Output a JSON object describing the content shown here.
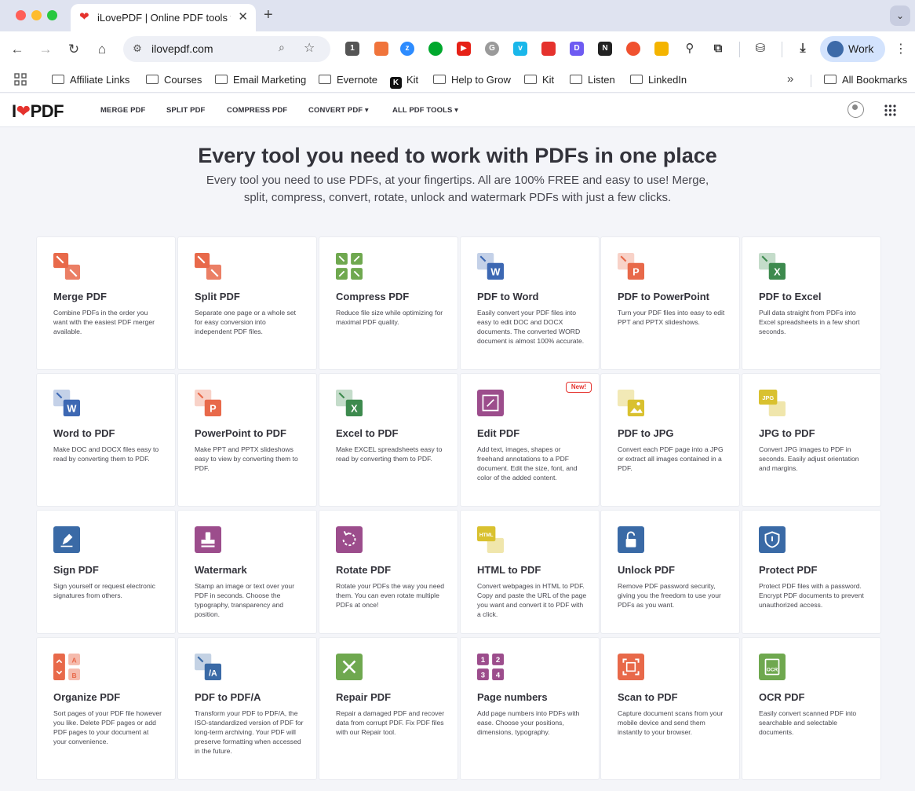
{
  "browser": {
    "tab_title": "iLovePDF | Online PDF tools for PDF lovers",
    "url": "ilovepdf.com",
    "profile": "Work",
    "extension_badge": "1",
    "bookmarks": [
      "Affiliate Links",
      "Courses",
      "Email Marketing",
      "Evernote",
      "Kit",
      "Help to Grow",
      "Kit",
      "Listen",
      "LinkedIn"
    ],
    "all_bookmarks": "All Bookmarks"
  },
  "site": {
    "logo_prefix": "I",
    "logo_suffix": "PDF",
    "nav": [
      "MERGE PDF",
      "SPLIT PDF",
      "COMPRESS PDF",
      "CONVERT PDF ▾",
      "ALL PDF TOOLS ▾"
    ]
  },
  "hero": {
    "title": "Every tool you need to work with PDFs in one place",
    "subtitle": "Every tool you need to use PDFs, at your fingertips. All are 100% FREE and easy to use! Merge, split, compress, convert, rotate, unlock and watermark PDFs with just a few clicks."
  },
  "tools": [
    {
      "title": "Merge PDF",
      "desc": "Combine PDFs in the order you want with the easiest PDF merger available.",
      "color": "#e8694a",
      "icon": "merge-icon"
    },
    {
      "title": "Split PDF",
      "desc": "Separate one page or a whole set for easy conversion into independent PDF files.",
      "color": "#e8694a",
      "icon": "split-icon"
    },
    {
      "title": "Compress PDF",
      "desc": "Reduce file size while optimizing for maximal PDF quality.",
      "color": "#6fa84f",
      "icon": "compress-icon"
    },
    {
      "title": "PDF to Word",
      "desc": "Easily convert your PDF files into easy to edit DOC and DOCX documents. The converted WORD document is almost 100% accurate.",
      "color": "#3d68b3",
      "icon": "word-icon",
      "glyph": "W"
    },
    {
      "title": "PDF to PowerPoint",
      "desc": "Turn your PDF files into easy to edit PPT and PPTX slideshows.",
      "color": "#e8694a",
      "icon": "powerpoint-icon",
      "glyph": "P"
    },
    {
      "title": "PDF to Excel",
      "desc": "Pull data straight from PDFs into Excel spreadsheets in a few short seconds.",
      "color": "#3d8a4e",
      "icon": "excel-icon",
      "glyph": "X"
    },
    {
      "title": "Word to PDF",
      "desc": "Make DOC and DOCX files easy to read by converting them to PDF.",
      "color": "#3d68b3",
      "icon": "word-icon",
      "glyph": "W"
    },
    {
      "title": "PowerPoint to PDF",
      "desc": "Make PPT and PPTX slideshows easy to view by converting them to PDF.",
      "color": "#e8694a",
      "icon": "powerpoint-icon",
      "glyph": "P"
    },
    {
      "title": "Excel to PDF",
      "desc": "Make EXCEL spreadsheets easy to read by converting them to PDF.",
      "color": "#3d8a4e",
      "icon": "excel-icon",
      "glyph": "X"
    },
    {
      "title": "Edit PDF",
      "desc": "Add text, images, shapes or freehand annotations to a PDF document. Edit the size, font, and color of the added content.",
      "color": "#9c4d8c",
      "icon": "edit-icon",
      "badge": "New!"
    },
    {
      "title": "PDF to JPG",
      "desc": "Convert each PDF page into a JPG or extract all images contained in a PDF.",
      "color": "#d9c12f",
      "icon": "image-icon"
    },
    {
      "title": "JPG to PDF",
      "desc": "Convert JPG images to PDF in seconds. Easily adjust orientation and margins.",
      "color": "#d9c12f",
      "icon": "jpg-icon",
      "glyph": "JPG"
    },
    {
      "title": "Sign PDF",
      "desc": "Sign yourself or request electronic signatures from others.",
      "color": "#3a6aa6",
      "icon": "pen-icon"
    },
    {
      "title": "Watermark",
      "desc": "Stamp an image or text over your PDF in seconds. Choose the typography, transparency and position.",
      "color": "#9c4d8c",
      "icon": "stamp-icon"
    },
    {
      "title": "Rotate PDF",
      "desc": "Rotate your PDFs the way you need them. You can even rotate multiple PDFs at once!",
      "color": "#9c4d8c",
      "icon": "rotate-icon"
    },
    {
      "title": "HTML to PDF",
      "desc": "Convert webpages in HTML to PDF. Copy and paste the URL of the page you want and convert it to PDF with a click.",
      "color": "#d9c12f",
      "icon": "html-icon",
      "glyph": "HTML"
    },
    {
      "title": "Unlock PDF",
      "desc": "Remove PDF password security, giving you the freedom to use your PDFs as you want.",
      "color": "#3a6aa6",
      "icon": "unlock-icon"
    },
    {
      "title": "Protect PDF",
      "desc": "Protect PDF files with a password. Encrypt PDF documents to prevent unauthorized access.",
      "color": "#3a6aa6",
      "icon": "shield-icon"
    },
    {
      "title": "Organize PDF",
      "desc": "Sort pages of your PDF file however you like. Delete PDF pages or add PDF pages to your document at your convenience.",
      "color": "#e8694a",
      "icon": "organize-icon"
    },
    {
      "title": "PDF to PDF/A",
      "desc": "Transform your PDF to PDF/A, the ISO-standardized version of PDF for long-term archiving. Your PDF will preserve formatting when accessed in the future.",
      "color": "#3a6aa6",
      "icon": "pdfa-icon",
      "glyph": "/A"
    },
    {
      "title": "Repair PDF",
      "desc": "Repair a damaged PDF and recover data from corrupt PDF. Fix PDF files with our Repair tool.",
      "color": "#6fa84f",
      "icon": "wrench-icon"
    },
    {
      "title": "Page numbers",
      "desc": "Add page numbers into PDFs with ease. Choose your positions, dimensions, typography.",
      "color": "#9c4d8c",
      "icon": "page-numbers-icon"
    },
    {
      "title": "Scan to PDF",
      "desc": "Capture document scans from your mobile device and send them instantly to your browser.",
      "color": "#e8694a",
      "icon": "scan-icon"
    },
    {
      "title": "OCR PDF",
      "desc": "Easily convert scanned PDF into searchable and selectable documents.",
      "color": "#6fa84f",
      "icon": "ocr-icon",
      "glyph": "OCR"
    }
  ]
}
